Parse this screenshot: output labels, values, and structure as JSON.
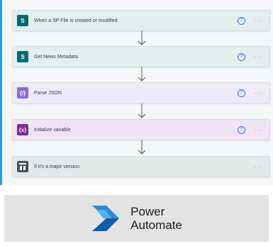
{
  "flow": {
    "steps": [
      {
        "label": "When a SP File is created or modified",
        "icon": "sharepoint-icon",
        "color": "#036c70",
        "tint": "#e4eeec",
        "help": true
      },
      {
        "label": "Get News Metadata",
        "icon": "sharepoint-icon",
        "color": "#036c70",
        "tint": "#e4eeec",
        "help": true
      },
      {
        "label": "Parse JSON",
        "icon": "data-operation-icon",
        "color": "#8c6cd6",
        "tint": "#efeaf8",
        "help": true
      },
      {
        "label": "Initialize variable",
        "icon": "variable-icon",
        "color": "#7a2b8e",
        "tint": "#efe5f2",
        "help": true
      },
      {
        "label": "If it's a major version",
        "icon": "condition-icon",
        "color": "#485056",
        "tint": "#e6e7e8",
        "help": false
      }
    ],
    "more_glyph": "···",
    "help_glyph": "?"
  },
  "branding": {
    "line1": "Power",
    "line2": "Automate",
    "accent": "#2a7de1"
  }
}
